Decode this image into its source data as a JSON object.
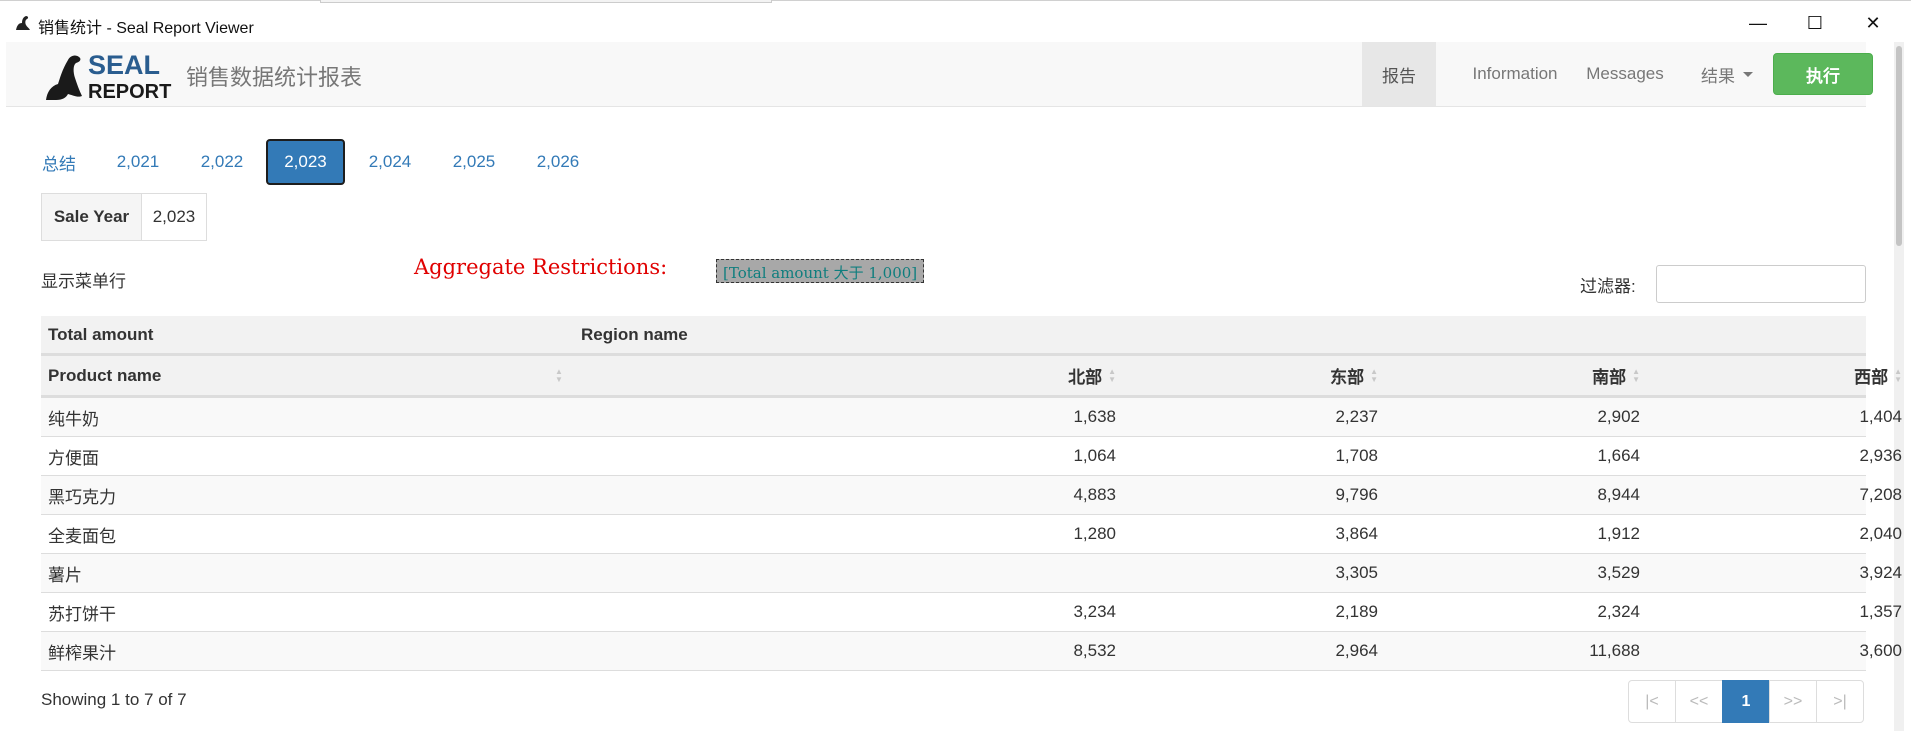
{
  "window": {
    "title": "销售统计 - Seal Report Viewer",
    "icon": "seal-icon",
    "controls": {
      "minimize": "—",
      "maximize": "☐",
      "close": "✕"
    }
  },
  "navbar": {
    "logo_text_top": "SEAL",
    "logo_text_bottom": "REPORT",
    "report_title": "销售数据统计报表",
    "items": [
      {
        "label": "报告",
        "active": true
      },
      {
        "label": "Information",
        "active": false
      },
      {
        "label": "Messages",
        "active": false
      },
      {
        "label": "结果",
        "active": false,
        "dropdown": true
      }
    ],
    "execute_label": "执行",
    "colors": {
      "execute": "#5cb85c",
      "active_tab": "#337ab7",
      "link": "#337ab7"
    }
  },
  "tabs": {
    "items": [
      "总结",
      "2,021",
      "2,022",
      "2,023",
      "2,024",
      "2,025",
      "2,026"
    ],
    "active_index": 3
  },
  "restriction": {
    "label": "Sale Year",
    "value": "2,023"
  },
  "toolbar": {
    "show_menu": "显示菜单行",
    "aggregate_label": "Aggregate Restrictions:",
    "aggregate_value": "[Total amount 大于 1,000]",
    "filter_label": "过滤器:"
  },
  "table": {
    "header1": {
      "col1": "Total amount",
      "col2": "Region name"
    },
    "header2": [
      "Product name",
      "北部",
      "东部",
      "南部",
      "西部"
    ],
    "rows": [
      [
        "纯牛奶",
        "1,638",
        "2,237",
        "2,902",
        "1,404"
      ],
      [
        "方便面",
        "1,064",
        "1,708",
        "1,664",
        "2,936"
      ],
      [
        "黑巧克力",
        "4,883",
        "9,796",
        "8,944",
        "7,208"
      ],
      [
        "全麦面包",
        "1,280",
        "3,864",
        "1,912",
        "2,040"
      ],
      [
        "薯片",
        "",
        "3,305",
        "3,529",
        "3,924"
      ],
      [
        "苏打饼干",
        "3,234",
        "2,189",
        "2,324",
        "1,357"
      ],
      [
        "鲜榨果汁",
        "8,532",
        "2,964",
        "11,688",
        "3,600"
      ]
    ]
  },
  "footer": {
    "showing": "Showing 1 to 7 of 7",
    "pager": [
      "|<",
      "<<",
      "1",
      ">>",
      ">|"
    ],
    "current_page": "1"
  }
}
